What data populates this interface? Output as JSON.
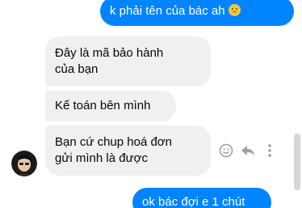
{
  "messages": [
    {
      "text": "k phải tên của bác ah",
      "sender": "me",
      "emoji": "worried-face-emoji"
    },
    {
      "text_lines": [
        "Đây là mã bảo hành",
        "của bạn"
      ],
      "sender": "other"
    },
    {
      "text": "Kế toán bên mình",
      "sender": "other"
    },
    {
      "text_lines": [
        "Bạn cứ chup hoá đơn",
        "gửi mình là được"
      ],
      "sender": "other"
    },
    {
      "text": "ok bác đợi e 1 chút",
      "sender": "me"
    }
  ],
  "message_actions": [
    "emoji-reaction-icon",
    "reply-icon",
    "more-options-icon"
  ],
  "colors": {
    "sent_bubble": "#0084ff",
    "received_bubble": "#f1f0f0",
    "received_text": "#050505",
    "action_icon": "#9aa0a6"
  }
}
